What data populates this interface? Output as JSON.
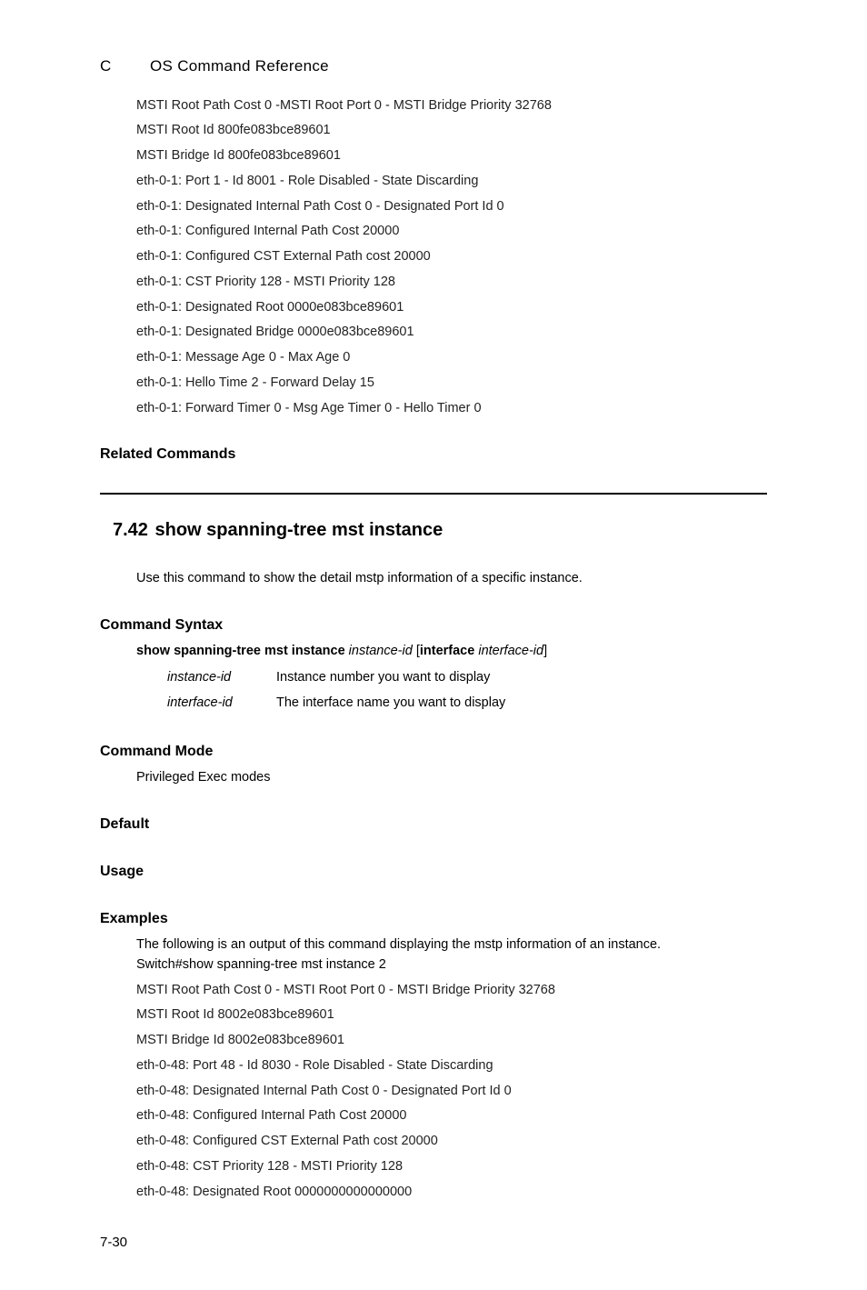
{
  "header": {
    "left": "C",
    "title": "OS Command Reference"
  },
  "top_output": {
    "lines": [
      "MSTI Root Path Cost 0 -MSTI Root Port 0 - MSTI Bridge Priority 32768",
      "MSTI Root Id 800fe083bce89601",
      "MSTI Bridge Id 800fe083bce89601",
      "eth-0-1: Port 1 - Id 8001 - Role Disabled - State Discarding",
      "eth-0-1: Designated Internal Path Cost 0    - Designated Port Id 0",
      "eth-0-1: Configured Internal Path Cost 20000",
      "eth-0-1: Configured CST External Path cost 20000",
      "eth-0-1: CST Priority 128    - MSTI Priority 128",
      "eth-0-1: Designated Root 0000e083bce89601",
      "eth-0-1: Designated Bridge 0000e083bce89601",
      "eth-0-1: Message Age 0 - Max Age 0",
      "eth-0-1: Hello Time 2 - Forward Delay 15",
      "eth-0-1: Forward Timer 0 - Msg Age Timer 0 - Hello Timer 0"
    ]
  },
  "related_heading": "Related Commands",
  "section": {
    "num": "7.42",
    "title": "show spanning-tree mst instance",
    "desc": "Use this command to show the detail mstp information of a specific instance."
  },
  "syntax": {
    "heading": "Command Syntax",
    "kw1": "show spanning-tree mst instance",
    "arg1": "instance-id",
    "br_open": "[",
    "kw2": "interface",
    "arg2": "interface-id",
    "br_close": "]",
    "params": [
      {
        "name": "instance-id",
        "desc": "Instance number you want to display"
      },
      {
        "name": "interface-id",
        "desc": "The interface name you want to display"
      }
    ]
  },
  "mode": {
    "heading": "Command Mode",
    "text": "Privileged Exec modes"
  },
  "default": {
    "heading": "Default"
  },
  "usage": {
    "heading": "Usage"
  },
  "examples": {
    "heading": "Examples",
    "intro": "The following is an output of this command displaying the mstp information of an instance.",
    "cmd": "Switch#show spanning-tree mst instance 2",
    "lines": [
      " MSTI Root Path Cost 0 - MSTI Root Port 0 - MSTI Bridge Priority 32768",
      " MSTI Root Id 8002e083bce89601",
      " MSTI Bridge Id 8002e083bce89601",
      " eth-0-48: Port 48 - Id 8030 - Role Disabled - State Discarding",
      " eth-0-48: Designated Internal Path Cost 0    - Designated Port Id 0",
      " eth-0-48: Configured Internal Path Cost 20000",
      " eth-0-48: Configured CST External Path cost 20000",
      " eth-0-48: CST Priority 128    - MSTI Priority 128",
      " eth-0-48: Designated Root 0000000000000000"
    ]
  },
  "page_num": "7-30"
}
